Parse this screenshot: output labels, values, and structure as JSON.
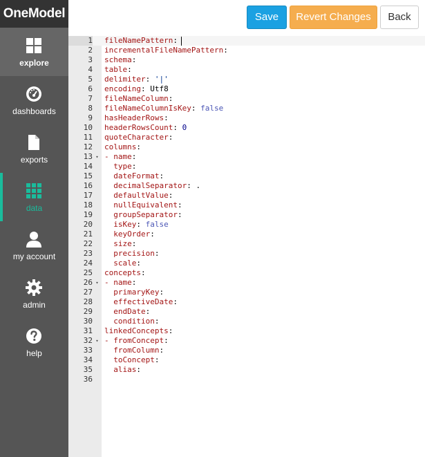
{
  "brand": "OneModel",
  "nav": [
    {
      "label": "explore",
      "icon": "grid-icon",
      "state": "selected"
    },
    {
      "label": "dashboards",
      "icon": "gauge-icon",
      "state": "normal"
    },
    {
      "label": "exports",
      "icon": "document-icon",
      "state": "normal"
    },
    {
      "label": "data",
      "icon": "data-grid-icon",
      "state": "current"
    },
    {
      "label": "my account",
      "icon": "user-icon",
      "state": "normal"
    },
    {
      "label": "admin",
      "icon": "gear-icon",
      "state": "normal"
    },
    {
      "label": "help",
      "icon": "help-icon",
      "state": "normal"
    }
  ],
  "toolbar": {
    "save_label": "Save",
    "revert_label": "Revert Changes",
    "back_label": "Back"
  },
  "colors": {
    "sidebar": "#555555",
    "brand_bar": "#333333",
    "accent": "#1abc9c",
    "save": "#1ba1e2",
    "revert": "#f5ad4e"
  },
  "editor": {
    "active_line": 1,
    "lines": [
      {
        "n": "1",
        "fold": "",
        "key": "fileNamePattern",
        "sep": ":",
        "value": "",
        "vtype": ""
      },
      {
        "n": "2",
        "fold": "",
        "key": "incrementalFileNamePattern",
        "sep": ":",
        "value": "",
        "vtype": ""
      },
      {
        "n": "3",
        "fold": "",
        "key": "schema",
        "sep": ":",
        "value": "",
        "vtype": ""
      },
      {
        "n": "4",
        "fold": "",
        "key": "table",
        "sep": ":",
        "value": "",
        "vtype": ""
      },
      {
        "n": "5",
        "fold": "",
        "key": "delimiter",
        "sep": ":",
        "value": "'|'",
        "vtype": "s"
      },
      {
        "n": "6",
        "fold": "",
        "key": "encoding",
        "sep": ":",
        "value": "Utf8",
        "vtype": "v"
      },
      {
        "n": "7",
        "fold": "",
        "key": "fileNameColumn",
        "sep": ":",
        "value": "",
        "vtype": ""
      },
      {
        "n": "8",
        "fold": "",
        "key": "fileNameColumnIsKey",
        "sep": ":",
        "value": "false",
        "vtype": "b"
      },
      {
        "n": "9",
        "fold": "",
        "key": "hasHeaderRows",
        "sep": ":",
        "value": "",
        "vtype": ""
      },
      {
        "n": "10",
        "fold": "",
        "key": "headerRowsCount",
        "sep": ":",
        "value": "0",
        "vtype": "n"
      },
      {
        "n": "11",
        "fold": "",
        "key": "quoteCharacter",
        "sep": ":",
        "value": "",
        "vtype": ""
      },
      {
        "n": "12",
        "fold": "",
        "key": "columns",
        "sep": ":",
        "value": "",
        "vtype": ""
      },
      {
        "n": "13",
        "fold": "▾",
        "key": "- name",
        "sep": ":",
        "value": "",
        "vtype": ""
      },
      {
        "n": "14",
        "fold": "",
        "key": "  type",
        "sep": ":",
        "value": "",
        "vtype": ""
      },
      {
        "n": "15",
        "fold": "",
        "key": "  dateFormat",
        "sep": ":",
        "value": "",
        "vtype": ""
      },
      {
        "n": "16",
        "fold": "",
        "key": "  decimalSeparator",
        "sep": ":",
        "value": ".",
        "vtype": "v"
      },
      {
        "n": "17",
        "fold": "",
        "key": "  defaultValue",
        "sep": ":",
        "value": "",
        "vtype": ""
      },
      {
        "n": "18",
        "fold": "",
        "key": "  nullEquivalent",
        "sep": ":",
        "value": "",
        "vtype": ""
      },
      {
        "n": "19",
        "fold": "",
        "key": "  groupSeparator",
        "sep": ":",
        "value": "",
        "vtype": ""
      },
      {
        "n": "20",
        "fold": "",
        "key": "  isKey",
        "sep": ":",
        "value": "false",
        "vtype": "b"
      },
      {
        "n": "21",
        "fold": "",
        "key": "  keyOrder",
        "sep": ":",
        "value": "",
        "vtype": ""
      },
      {
        "n": "22",
        "fold": "",
        "key": "  size",
        "sep": ":",
        "value": "",
        "vtype": ""
      },
      {
        "n": "23",
        "fold": "",
        "key": "  precision",
        "sep": ":",
        "value": "",
        "vtype": ""
      },
      {
        "n": "24",
        "fold": "",
        "key": "  scale",
        "sep": ":",
        "value": "",
        "vtype": ""
      },
      {
        "n": "25",
        "fold": "",
        "key": "concepts",
        "sep": ":",
        "value": "",
        "vtype": ""
      },
      {
        "n": "26",
        "fold": "▾",
        "key": "- name",
        "sep": ":",
        "value": "",
        "vtype": ""
      },
      {
        "n": "27",
        "fold": "",
        "key": "  primaryKey",
        "sep": ":",
        "value": "",
        "vtype": ""
      },
      {
        "n": "28",
        "fold": "",
        "key": "  effectiveDate",
        "sep": ":",
        "value": "",
        "vtype": ""
      },
      {
        "n": "29",
        "fold": "",
        "key": "  endDate",
        "sep": ":",
        "value": "",
        "vtype": ""
      },
      {
        "n": "30",
        "fold": "",
        "key": "  condition",
        "sep": ":",
        "value": "",
        "vtype": ""
      },
      {
        "n": "31",
        "fold": "",
        "key": "linkedConcepts",
        "sep": ":",
        "value": "",
        "vtype": ""
      },
      {
        "n": "32",
        "fold": "▾",
        "key": "- fromConcept",
        "sep": ":",
        "value": "",
        "vtype": ""
      },
      {
        "n": "33",
        "fold": "",
        "key": "  fromColumn",
        "sep": ":",
        "value": "",
        "vtype": ""
      },
      {
        "n": "34",
        "fold": "",
        "key": "  toConcept",
        "sep": ":",
        "value": "",
        "vtype": ""
      },
      {
        "n": "35",
        "fold": "",
        "key": "  alias",
        "sep": ":",
        "value": "",
        "vtype": ""
      },
      {
        "n": "36",
        "fold": "",
        "key": "",
        "sep": "",
        "value": "",
        "vtype": ""
      }
    ]
  }
}
